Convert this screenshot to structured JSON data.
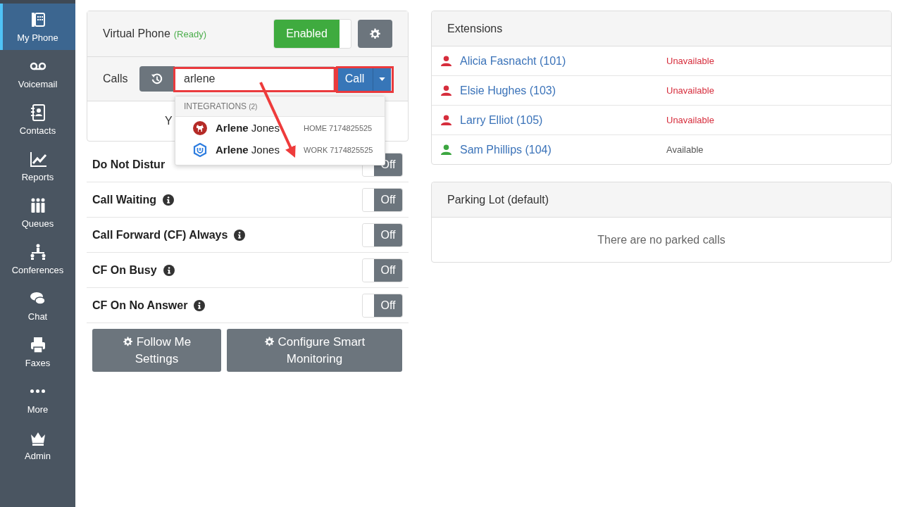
{
  "sidebar": {
    "items": [
      {
        "label": "My Phone",
        "kind": "phone",
        "selected": true
      },
      {
        "label": "Voicemail",
        "kind": "voicemail",
        "selected": false
      },
      {
        "label": "Contacts",
        "kind": "contacts",
        "selected": false
      },
      {
        "label": "Reports",
        "kind": "reports",
        "selected": false
      },
      {
        "label": "Queues",
        "kind": "queues",
        "selected": false
      },
      {
        "label": "Conferences",
        "kind": "conferences",
        "selected": false
      },
      {
        "label": "Chat",
        "kind": "chat",
        "selected": false
      },
      {
        "label": "Faxes",
        "kind": "faxes",
        "selected": false
      },
      {
        "label": "More",
        "kind": "more",
        "selected": false
      },
      {
        "label": "Admin",
        "kind": "admin",
        "selected": false
      }
    ]
  },
  "virtual_phone": {
    "title": "Virtual Phone",
    "status": "(Ready)",
    "toggle": {
      "label": "Enabled",
      "on": true
    }
  },
  "calls": {
    "label": "Calls",
    "search": {
      "value": "arlene"
    },
    "call_button": "Call",
    "body_text": "Y"
  },
  "suggestions": {
    "header": "INTEGRATIONS",
    "count": "(2)",
    "items": [
      {
        "kind": "pet",
        "match": "Arlene",
        "rest": "Jones",
        "detail": "HOME 7174825525"
      },
      {
        "kind": "hexagon",
        "match": "Arlene",
        "rest": "Jones",
        "detail": "WORK 7174825525"
      }
    ]
  },
  "settings": [
    {
      "label": "Do Not Distur",
      "toggle": {
        "label": "Off",
        "on": false
      }
    },
    {
      "label": "Call Waiting",
      "info": true,
      "toggle": {
        "label": "Off",
        "on": false
      }
    },
    {
      "label": "Call Forward (CF) Always",
      "info": true,
      "toggle": {
        "label": "Off",
        "on": false
      }
    },
    {
      "label": "CF On Busy",
      "info": true,
      "toggle": {
        "label": "Off",
        "on": false
      }
    },
    {
      "label": "CF On No Answer",
      "info": true,
      "toggle": {
        "label": "Off",
        "on": false
      }
    }
  ],
  "buttons": [
    "Follow Me Settings",
    "Configure Smart Monitoring"
  ],
  "extensions": {
    "title": "Extensions",
    "items": [
      {
        "name": "Alicia Fasnacht (101)",
        "status": "Unavailable",
        "available": false
      },
      {
        "name": "Elsie Hughes (103)",
        "status": "Unavailable",
        "available": false
      },
      {
        "name": "Larry Elliot (105)",
        "status": "Unavailable",
        "available": false
      },
      {
        "name": "Sam Phillips (104)",
        "status": "Available",
        "available": true
      }
    ]
  },
  "parking_lot": {
    "title": "Parking Lot (default)",
    "empty_text": "There are no parked calls"
  },
  "annotation": {
    "highlight_search": true,
    "highlight_call_button": true,
    "arrow": true
  }
}
